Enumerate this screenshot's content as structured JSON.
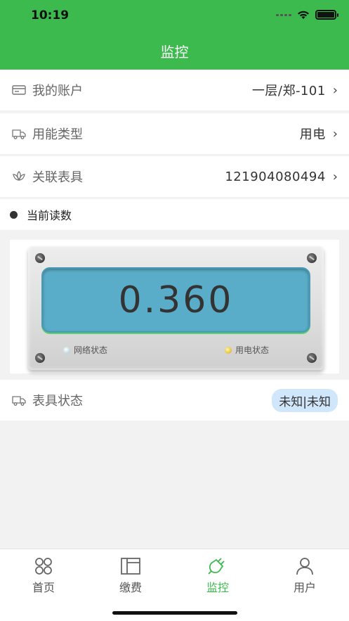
{
  "status_bar": {
    "time": "10:19"
  },
  "header": {
    "title": "监控"
  },
  "rows": {
    "account": {
      "label": "我的账户",
      "value": "一层/郑-101",
      "icon": "card-icon"
    },
    "energy_type": {
      "label": "用能类型",
      "value": "用电",
      "icon": "truck-icon"
    },
    "meter": {
      "label": "关联表具",
      "value": "121904080494",
      "icon": "lotus-icon"
    }
  },
  "reading_section": {
    "title": "当前读数"
  },
  "meter_display": {
    "reading": "0.360",
    "network_status_label": "网络状态",
    "power_status_label": "用电状态",
    "lcd_color": "#5aadc9"
  },
  "meter_status": {
    "label": "表具状态",
    "badge": "未知|未知"
  },
  "tabbar": {
    "tabs": [
      {
        "label": "首页",
        "icon": "grid-circles-icon",
        "active": false
      },
      {
        "label": "缴费",
        "icon": "layout-icon",
        "active": false
      },
      {
        "label": "监控",
        "icon": "plug-icon",
        "active": true
      },
      {
        "label": "用户",
        "icon": "user-icon",
        "active": false
      }
    ]
  },
  "colors": {
    "accent": "#3dba4e",
    "badge_bg": "#cfe6fb"
  }
}
